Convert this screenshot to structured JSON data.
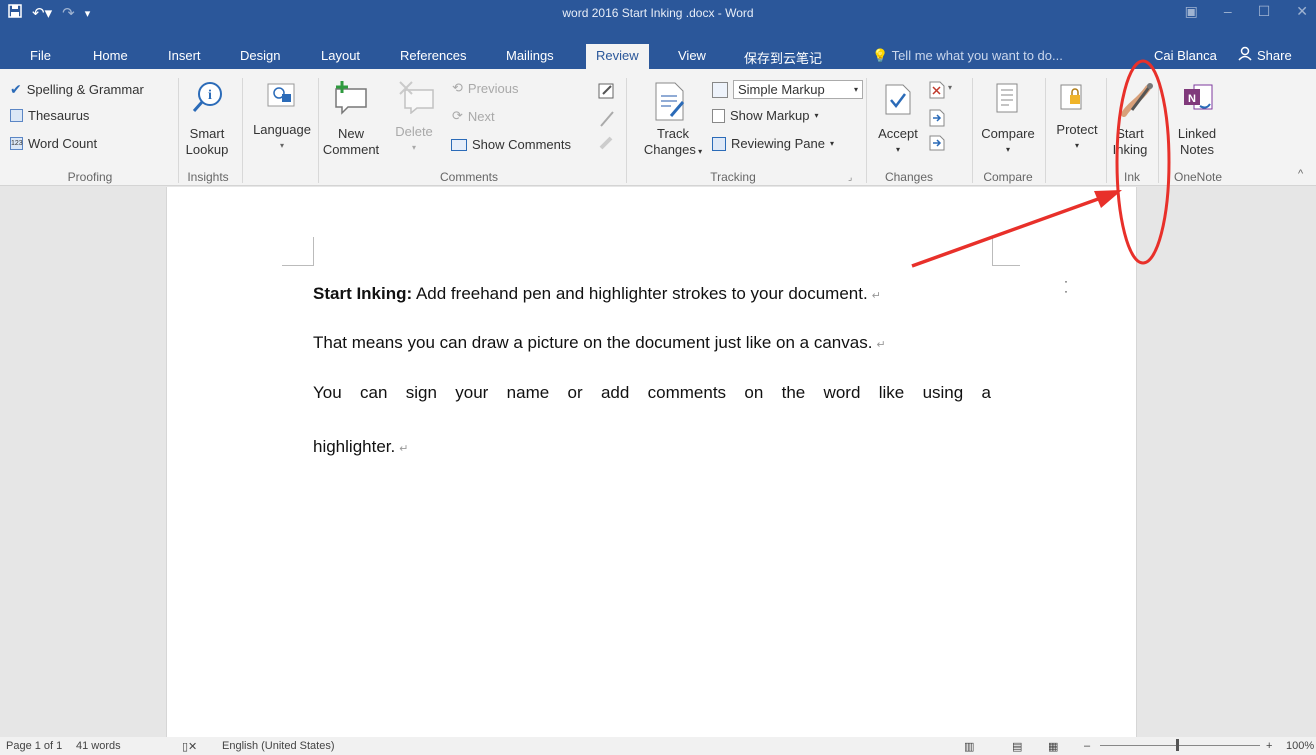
{
  "window": {
    "title": "word 2016 Start Inking .docx - Word"
  },
  "qat": {
    "save_icon": "save-icon",
    "undo_icon": "undo-icon",
    "redo_icon": "redo-icon"
  },
  "tabs": [
    {
      "label": "File"
    },
    {
      "label": "Home"
    },
    {
      "label": "Insert"
    },
    {
      "label": "Design"
    },
    {
      "label": "Layout"
    },
    {
      "label": "References"
    },
    {
      "label": "Mailings"
    },
    {
      "label": "Review"
    },
    {
      "label": "View"
    },
    {
      "label": "保存到云笔记"
    }
  ],
  "tell_me": "Tell me what you want to do...",
  "user": "Cai Blanca",
  "share": "Share",
  "ribbon": {
    "proofing": {
      "spelling": "Spelling & Grammar",
      "thesaurus": "Thesaurus",
      "word_count": "Word Count",
      "group": "Proofing"
    },
    "insights": {
      "smart": "Smart",
      "lookup": "Lookup",
      "group": "Insights"
    },
    "language": {
      "label": "Language"
    },
    "comments": {
      "new1": "New",
      "new2": "Comment",
      "delete": "Delete",
      "previous": "Previous",
      "next": "Next",
      "show": "Show Comments",
      "group": "Comments"
    },
    "tracking": {
      "track1": "Track",
      "track2": "Changes",
      "markup": "Simple Markup",
      "show_markup": "Show Markup",
      "reviewing": "Reviewing Pane",
      "group": "Tracking"
    },
    "changes": {
      "accept": "Accept",
      "group": "Changes"
    },
    "compare": {
      "label": "Compare",
      "group": "Compare"
    },
    "protect": {
      "label": "Protect"
    },
    "ink": {
      "start": "Start",
      "inking": "Inking",
      "group": "Ink"
    },
    "onenote": {
      "linked": "Linked",
      "notes": "Notes",
      "group": "OneNote"
    }
  },
  "document": {
    "p1_bold": "Start Inking:",
    "p1_rest": " Add freehand pen and highlighter strokes to your document.",
    "p2": "That means you can draw a picture on the document just like on a canvas.",
    "p3": "You can sign your name or add comments on the word like using a",
    "p4": "highlighter."
  },
  "status": {
    "page": "Page 1 of 1",
    "words": "41 words",
    "language": "English (United States)",
    "zoom": "100%"
  },
  "colors": {
    "accent": "#2b579a",
    "annotation": "#e8302a"
  }
}
